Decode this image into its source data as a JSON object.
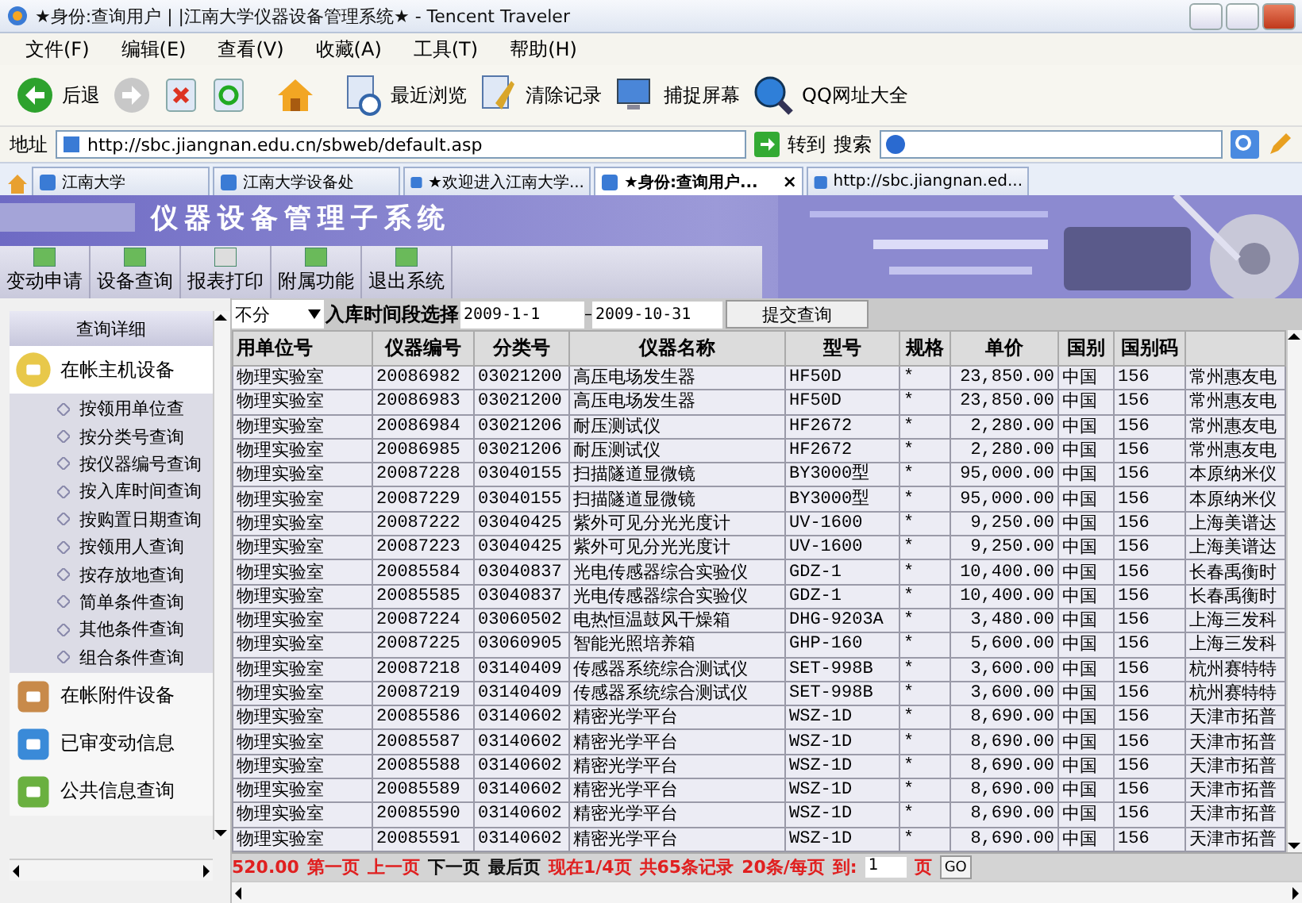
{
  "window": {
    "title": "★身份:查询用户 | |江南大学仪器设备管理系统★ - Tencent Traveler"
  },
  "menu": [
    "文件(F)",
    "编辑(E)",
    "查看(V)",
    "收藏(A)",
    "工具(T)",
    "帮助(H)"
  ],
  "toolbar": [
    {
      "kind": "back",
      "label": "后退"
    },
    {
      "kind": "forward"
    },
    {
      "kind": "stop"
    },
    {
      "kind": "refresh"
    },
    {
      "kind": "home"
    },
    {
      "kind": "history",
      "label": "最近浏览"
    },
    {
      "kind": "clear",
      "label": "清除记录"
    },
    {
      "kind": "capture",
      "label": "捕捉屏幕"
    },
    {
      "kind": "search",
      "label": "QQ网址大全"
    }
  ],
  "address_bar": {
    "label": "地址",
    "url": "http://sbc.jiangnan.edu.cn/sbweb/default.asp",
    "go": "转到",
    "search_label": "搜索"
  },
  "tabs": [
    {
      "label": "江南大学",
      "selected": false
    },
    {
      "label": "江南大学设备处",
      "selected": false
    },
    {
      "label": "★欢迎进入江南大学...",
      "selected": false
    },
    {
      "label": "★身份:查询用户...",
      "selected": true,
      "close": "×"
    },
    {
      "label": "http://sbc.jiangnan.ed...",
      "selected": false
    }
  ],
  "app": {
    "title": "仪器设备管理子系统",
    "nav": [
      "变动申请",
      "设备查询",
      "报表打印",
      "附属功能",
      "退出系统"
    ]
  },
  "sidebar": {
    "title": "查询详细",
    "groups": [
      {
        "label": "在帐主机设备",
        "expanded": true,
        "children": [
          "按领用单位查",
          "按分类号查询",
          "按仪器编号查询",
          "按入库时间查询",
          "按购置日期查询",
          "按领用人查询",
          "按存放地查询",
          "简单条件查询",
          "其他条件查询",
          "组合条件查询"
        ]
      },
      {
        "label": "在帐附件设备",
        "expanded": false
      },
      {
        "label": "已审变动信息",
        "expanded": false
      },
      {
        "label": "公共信息查询",
        "expanded": false
      }
    ]
  },
  "filter": {
    "select": "不分",
    "label": "入库时间段选择",
    "from": "2009-1-1",
    "separator": "–",
    "to": "2009-10-31",
    "submit": "提交查询"
  },
  "table": {
    "columns": [
      "用单位号",
      "仪器编号",
      "分类号",
      "仪器名称",
      "型号",
      "规格",
      "单价",
      "国别",
      "国别码"
    ],
    "rows": [
      [
        "物理实验室",
        "20086982",
        "03021200",
        "高压电场发生器",
        "HF50D",
        "*",
        "23,850.00",
        "中国",
        "156",
        "常州惠友电"
      ],
      [
        "物理实验室",
        "20086983",
        "03021200",
        "高压电场发生器",
        "HF50D",
        "*",
        "23,850.00",
        "中国",
        "156",
        "常州惠友电"
      ],
      [
        "物理实验室",
        "20086984",
        "03021206",
        "耐压测试仪",
        "HF2672",
        "*",
        "2,280.00",
        "中国",
        "156",
        "常州惠友电"
      ],
      [
        "物理实验室",
        "20086985",
        "03021206",
        "耐压测试仪",
        "HF2672",
        "*",
        "2,280.00",
        "中国",
        "156",
        "常州惠友电"
      ],
      [
        "物理实验室",
        "20087228",
        "03040155",
        "扫描隧道显微镜",
        "BY3000型",
        "*",
        "95,000.00",
        "中国",
        "156",
        "本原纳米仪"
      ],
      [
        "物理实验室",
        "20087229",
        "03040155",
        "扫描隧道显微镜",
        "BY3000型",
        "*",
        "95,000.00",
        "中国",
        "156",
        "本原纳米仪"
      ],
      [
        "物理实验室",
        "20087222",
        "03040425",
        "紫外可见分光光度计",
        "UV-1600",
        "*",
        "9,250.00",
        "中国",
        "156",
        "上海美谱达"
      ],
      [
        "物理实验室",
        "20087223",
        "03040425",
        "紫外可见分光光度计",
        "UV-1600",
        "*",
        "9,250.00",
        "中国",
        "156",
        "上海美谱达"
      ],
      [
        "物理实验室",
        "20085584",
        "03040837",
        "光电传感器综合实验仪",
        "GDZ-1",
        "*",
        "10,400.00",
        "中国",
        "156",
        "长春禹衡时"
      ],
      [
        "物理实验室",
        "20085585",
        "03040837",
        "光电传感器综合实验仪",
        "GDZ-1",
        "*",
        "10,400.00",
        "中国",
        "156",
        "长春禹衡时"
      ],
      [
        "物理实验室",
        "20087224",
        "03060502",
        "电热恒温鼓风干燥箱",
        "DHG-9203A",
        "*",
        "3,480.00",
        "中国",
        "156",
        "上海三发科"
      ],
      [
        "物理实验室",
        "20087225",
        "03060905",
        "智能光照培养箱",
        "GHP-160",
        "*",
        "5,600.00",
        "中国",
        "156",
        "上海三发科"
      ],
      [
        "物理实验室",
        "20087218",
        "03140409",
        "传感器系统综合测试仪",
        "SET-998B",
        "*",
        "3,600.00",
        "中国",
        "156",
        "杭州赛特特"
      ],
      [
        "物理实验室",
        "20087219",
        "03140409",
        "传感器系统综合测试仪",
        "SET-998B",
        "*",
        "3,600.00",
        "中国",
        "156",
        "杭州赛特特"
      ],
      [
        "物理实验室",
        "20085586",
        "03140602",
        "精密光学平台",
        "WSZ-1D",
        "*",
        "8,690.00",
        "中国",
        "156",
        "天津市拓普"
      ],
      [
        "物理实验室",
        "20085587",
        "03140602",
        "精密光学平台",
        "WSZ-1D",
        "*",
        "8,690.00",
        "中国",
        "156",
        "天津市拓普"
      ],
      [
        "物理实验室",
        "20085588",
        "03140602",
        "精密光学平台",
        "WSZ-1D",
        "*",
        "8,690.00",
        "中国",
        "156",
        "天津市拓普"
      ],
      [
        "物理实验室",
        "20085589",
        "03140602",
        "精密光学平台",
        "WSZ-1D",
        "*",
        "8,690.00",
        "中国",
        "156",
        "天津市拓普"
      ],
      [
        "物理实验室",
        "20085590",
        "03140602",
        "精密光学平台",
        "WSZ-1D",
        "*",
        "8,690.00",
        "中国",
        "156",
        "天津市拓普"
      ],
      [
        "物理实验室",
        "20085591",
        "03140602",
        "精密光学平台",
        "WSZ-1D",
        "*",
        "8,690.00",
        "中国",
        "156",
        "天津市拓普"
      ]
    ]
  },
  "pagination": [
    {
      "kind": "red",
      "text": "520.00"
    },
    {
      "kind": "red",
      "text": "第一页"
    },
    {
      "kind": "red",
      "text": "上一页"
    },
    {
      "kind": "link",
      "text": "下一页"
    },
    {
      "kind": "link",
      "text": "最后页"
    },
    {
      "kind": "red",
      "text": "现在1/4页"
    },
    {
      "kind": "red",
      "text": "共65条记录"
    },
    {
      "kind": "red",
      "text": "20条/每页"
    },
    {
      "kind": "red",
      "text": "到:"
    },
    {
      "kind": "input",
      "text": "1"
    },
    {
      "kind": "red",
      "text": "页"
    },
    {
      "kind": "button",
      "text": "GO"
    }
  ]
}
